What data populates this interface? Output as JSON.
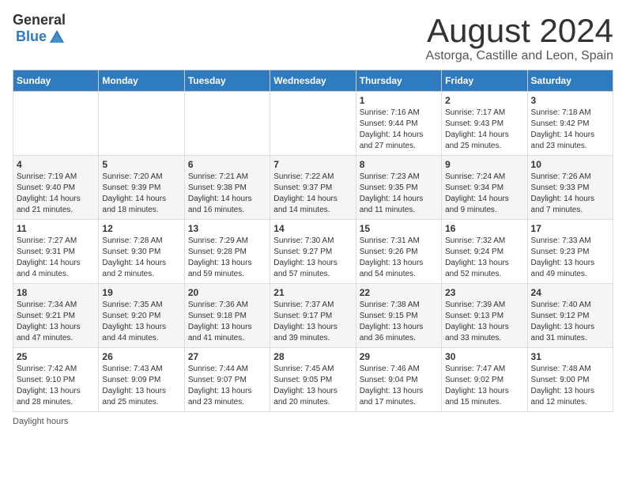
{
  "logo": {
    "general": "General",
    "blue": "Blue"
  },
  "title": "August 2024",
  "subtitle": "Astorga, Castille and Leon, Spain",
  "daylight_label": "Daylight hours",
  "days_of_week": [
    "Sunday",
    "Monday",
    "Tuesday",
    "Wednesday",
    "Thursday",
    "Friday",
    "Saturday"
  ],
  "weeks": [
    [
      {
        "day": "",
        "content": ""
      },
      {
        "day": "",
        "content": ""
      },
      {
        "day": "",
        "content": ""
      },
      {
        "day": "",
        "content": ""
      },
      {
        "day": "1",
        "content": "Sunrise: 7:16 AM\nSunset: 9:44 PM\nDaylight: 14 hours\nand 27 minutes."
      },
      {
        "day": "2",
        "content": "Sunrise: 7:17 AM\nSunset: 9:43 PM\nDaylight: 14 hours\nand 25 minutes."
      },
      {
        "day": "3",
        "content": "Sunrise: 7:18 AM\nSunset: 9:42 PM\nDaylight: 14 hours\nand 23 minutes."
      }
    ],
    [
      {
        "day": "4",
        "content": "Sunrise: 7:19 AM\nSunset: 9:40 PM\nDaylight: 14 hours\nand 21 minutes."
      },
      {
        "day": "5",
        "content": "Sunrise: 7:20 AM\nSunset: 9:39 PM\nDaylight: 14 hours\nand 18 minutes."
      },
      {
        "day": "6",
        "content": "Sunrise: 7:21 AM\nSunset: 9:38 PM\nDaylight: 14 hours\nand 16 minutes."
      },
      {
        "day": "7",
        "content": "Sunrise: 7:22 AM\nSunset: 9:37 PM\nDaylight: 14 hours\nand 14 minutes."
      },
      {
        "day": "8",
        "content": "Sunrise: 7:23 AM\nSunset: 9:35 PM\nDaylight: 14 hours\nand 11 minutes."
      },
      {
        "day": "9",
        "content": "Sunrise: 7:24 AM\nSunset: 9:34 PM\nDaylight: 14 hours\nand 9 minutes."
      },
      {
        "day": "10",
        "content": "Sunrise: 7:26 AM\nSunset: 9:33 PM\nDaylight: 14 hours\nand 7 minutes."
      }
    ],
    [
      {
        "day": "11",
        "content": "Sunrise: 7:27 AM\nSunset: 9:31 PM\nDaylight: 14 hours\nand 4 minutes."
      },
      {
        "day": "12",
        "content": "Sunrise: 7:28 AM\nSunset: 9:30 PM\nDaylight: 14 hours\nand 2 minutes."
      },
      {
        "day": "13",
        "content": "Sunrise: 7:29 AM\nSunset: 9:28 PM\nDaylight: 13 hours\nand 59 minutes."
      },
      {
        "day": "14",
        "content": "Sunrise: 7:30 AM\nSunset: 9:27 PM\nDaylight: 13 hours\nand 57 minutes."
      },
      {
        "day": "15",
        "content": "Sunrise: 7:31 AM\nSunset: 9:26 PM\nDaylight: 13 hours\nand 54 minutes."
      },
      {
        "day": "16",
        "content": "Sunrise: 7:32 AM\nSunset: 9:24 PM\nDaylight: 13 hours\nand 52 minutes."
      },
      {
        "day": "17",
        "content": "Sunrise: 7:33 AM\nSunset: 9:23 PM\nDaylight: 13 hours\nand 49 minutes."
      }
    ],
    [
      {
        "day": "18",
        "content": "Sunrise: 7:34 AM\nSunset: 9:21 PM\nDaylight: 13 hours\nand 47 minutes."
      },
      {
        "day": "19",
        "content": "Sunrise: 7:35 AM\nSunset: 9:20 PM\nDaylight: 13 hours\nand 44 minutes."
      },
      {
        "day": "20",
        "content": "Sunrise: 7:36 AM\nSunset: 9:18 PM\nDaylight: 13 hours\nand 41 minutes."
      },
      {
        "day": "21",
        "content": "Sunrise: 7:37 AM\nSunset: 9:17 PM\nDaylight: 13 hours\nand 39 minutes."
      },
      {
        "day": "22",
        "content": "Sunrise: 7:38 AM\nSunset: 9:15 PM\nDaylight: 13 hours\nand 36 minutes."
      },
      {
        "day": "23",
        "content": "Sunrise: 7:39 AM\nSunset: 9:13 PM\nDaylight: 13 hours\nand 33 minutes."
      },
      {
        "day": "24",
        "content": "Sunrise: 7:40 AM\nSunset: 9:12 PM\nDaylight: 13 hours\nand 31 minutes."
      }
    ],
    [
      {
        "day": "25",
        "content": "Sunrise: 7:42 AM\nSunset: 9:10 PM\nDaylight: 13 hours\nand 28 minutes."
      },
      {
        "day": "26",
        "content": "Sunrise: 7:43 AM\nSunset: 9:09 PM\nDaylight: 13 hours\nand 25 minutes."
      },
      {
        "day": "27",
        "content": "Sunrise: 7:44 AM\nSunset: 9:07 PM\nDaylight: 13 hours\nand 23 minutes."
      },
      {
        "day": "28",
        "content": "Sunrise: 7:45 AM\nSunset: 9:05 PM\nDaylight: 13 hours\nand 20 minutes."
      },
      {
        "day": "29",
        "content": "Sunrise: 7:46 AM\nSunset: 9:04 PM\nDaylight: 13 hours\nand 17 minutes."
      },
      {
        "day": "30",
        "content": "Sunrise: 7:47 AM\nSunset: 9:02 PM\nDaylight: 13 hours\nand 15 minutes."
      },
      {
        "day": "31",
        "content": "Sunrise: 7:48 AM\nSunset: 9:00 PM\nDaylight: 13 hours\nand 12 minutes."
      }
    ]
  ]
}
